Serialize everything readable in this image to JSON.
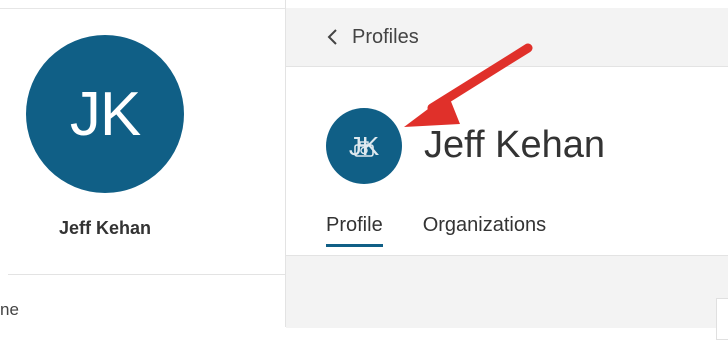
{
  "sidebar": {
    "avatar_initials": "JK",
    "user_name": "Jeff Kehan",
    "bottom_text": "ne"
  },
  "header": {
    "back_label": "Profiles",
    "back_icon": "chevron-left-icon"
  },
  "profile": {
    "avatar_initials": "JK",
    "avatar_icon": "camera-icon",
    "name": "Jeff Kehan"
  },
  "tabs": [
    {
      "label": "Profile",
      "active": true
    },
    {
      "label": "Organizations",
      "active": false
    }
  ],
  "colors": {
    "accent": "#105f86",
    "annotation_arrow": "#e0302a",
    "header_bg": "#f3f3f3"
  }
}
